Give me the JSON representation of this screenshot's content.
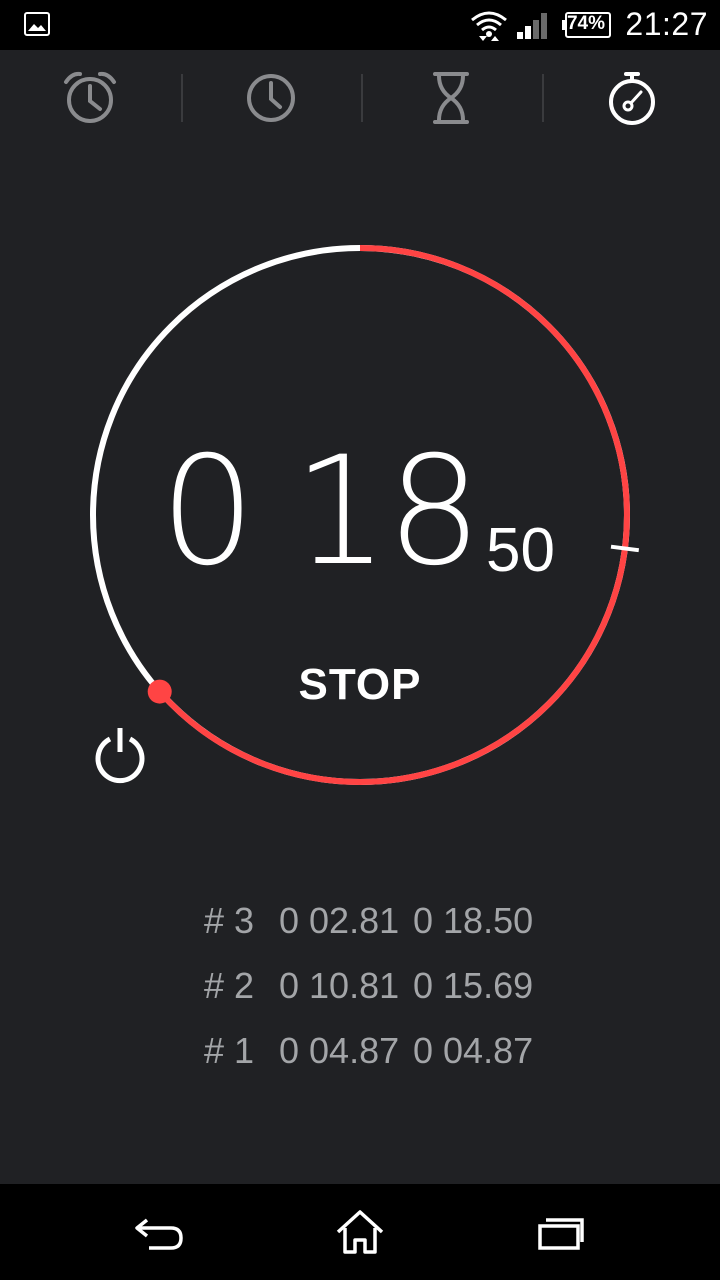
{
  "status_bar": {
    "time": "21:27",
    "battery_percent": "74%",
    "icons": [
      "gallery-notification-icon",
      "wifi-icon",
      "cell-signal-icon",
      "battery-icon"
    ]
  },
  "tabs": [
    {
      "name": "alarm",
      "icon": "alarm-clock-icon",
      "active": false
    },
    {
      "name": "clock",
      "icon": "clock-icon",
      "active": false
    },
    {
      "name": "timer",
      "icon": "hourglass-icon",
      "active": false
    },
    {
      "name": "stopwatch",
      "icon": "stopwatch-icon",
      "active": true
    }
  ],
  "stopwatch": {
    "minutes": "0",
    "seconds": "18",
    "hundredths": "50",
    "stop_label": "STOP",
    "lap_progress_fraction": 0.635,
    "lap_marker_fraction": 0.27
  },
  "laps": [
    {
      "number": "# 3",
      "lap_time": "0 02.81",
      "total_time": "0 18.50"
    },
    {
      "number": "# 2",
      "lap_time": "0 10.81",
      "total_time": "0 15.69"
    },
    {
      "number": "# 1",
      "lap_time": "0 04.87",
      "total_time": "0 04.87"
    }
  ],
  "nav_bar": {
    "icons": [
      "back-icon",
      "home-icon",
      "recent-apps-icon"
    ]
  },
  "colors": {
    "background": "#202124",
    "accent_red": "#ff4444",
    "text_white": "#ffffff",
    "lap_text": "#a3a5a8",
    "inactive_icon": "#8a8b8e"
  }
}
